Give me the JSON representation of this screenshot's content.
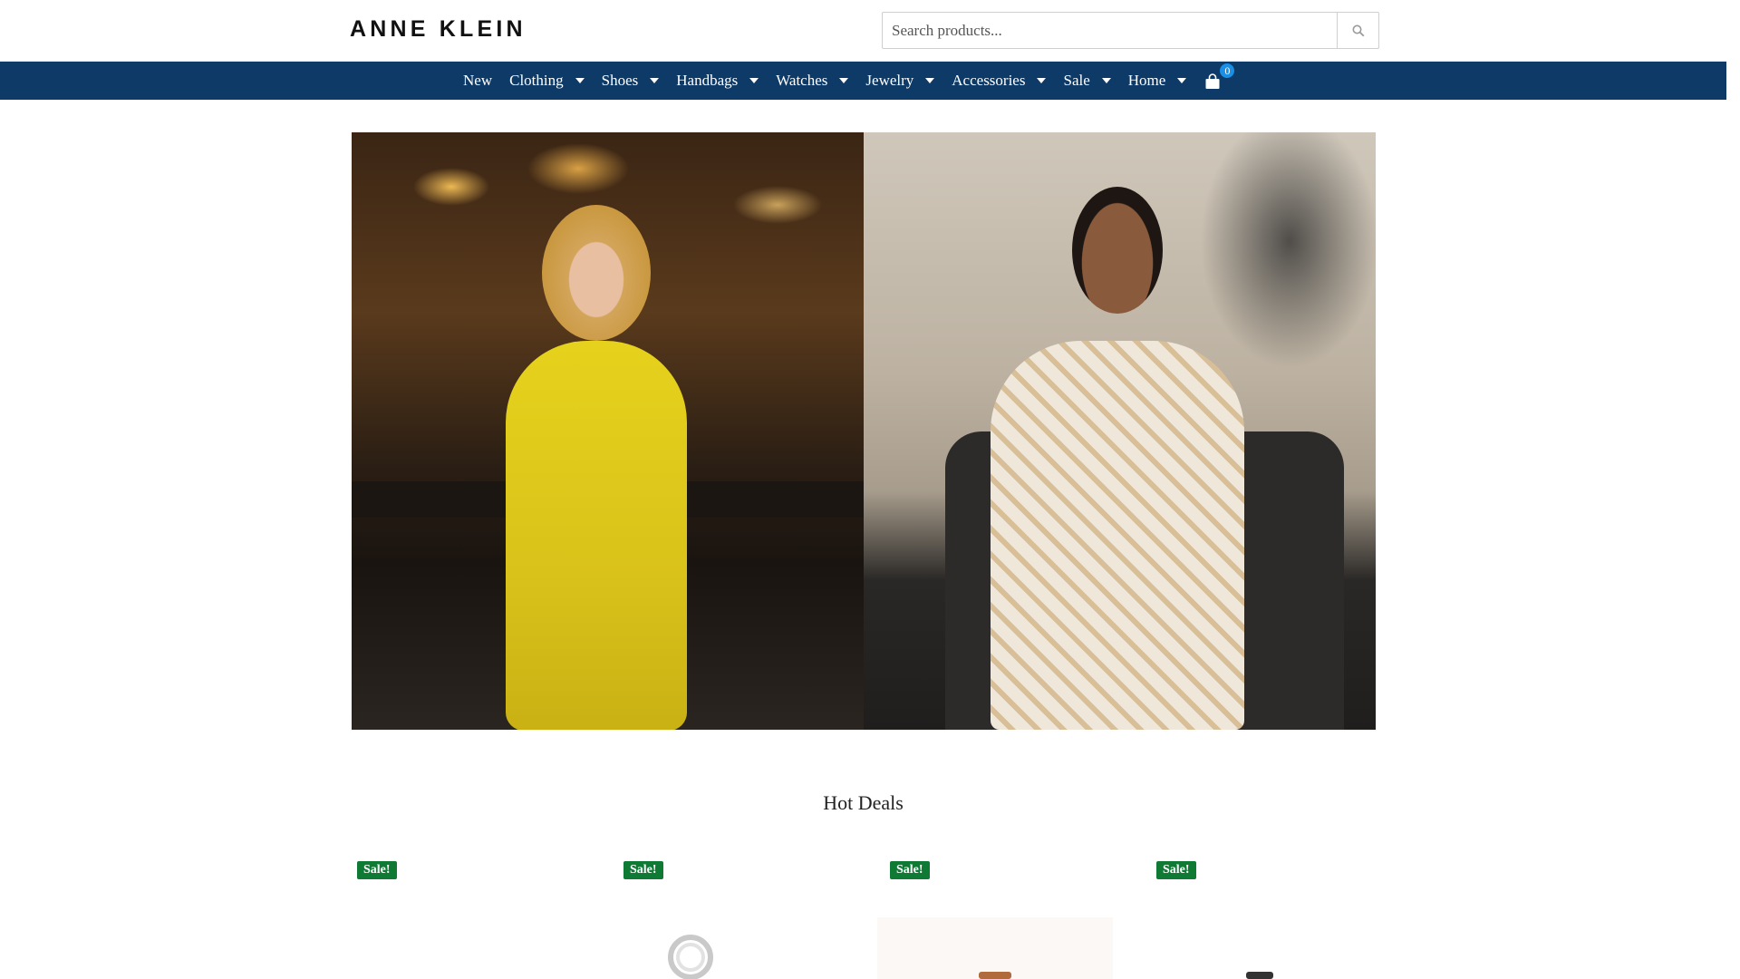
{
  "header": {
    "logo": "ANNE KLEIN",
    "search": {
      "placeholder": "Search products..."
    }
  },
  "nav": {
    "items": [
      {
        "label": "New",
        "has_dropdown": false
      },
      {
        "label": "Clothing",
        "has_dropdown": true
      },
      {
        "label": "Shoes",
        "has_dropdown": true
      },
      {
        "label": "Handbags",
        "has_dropdown": true
      },
      {
        "label": "Watches",
        "has_dropdown": true
      },
      {
        "label": "Jewelry",
        "has_dropdown": true
      },
      {
        "label": "Accessories",
        "has_dropdown": true
      },
      {
        "label": "Sale",
        "has_dropdown": true
      },
      {
        "label": "Home",
        "has_dropdown": true
      }
    ],
    "cart_count": "0"
  },
  "hero": {
    "panels": [
      "yellow sequin dress model at bar",
      "floral one-shoulder dress model in leather chair"
    ]
  },
  "deals": {
    "title": "Hot Deals",
    "badges": [
      "Sale!",
      "Sale!",
      "Sale!",
      "Sale!"
    ]
  },
  "colors": {
    "nav_bg": "#0d3a66",
    "sale_badge": "#0f7a34",
    "cart_badge": "#1a8fe6"
  }
}
